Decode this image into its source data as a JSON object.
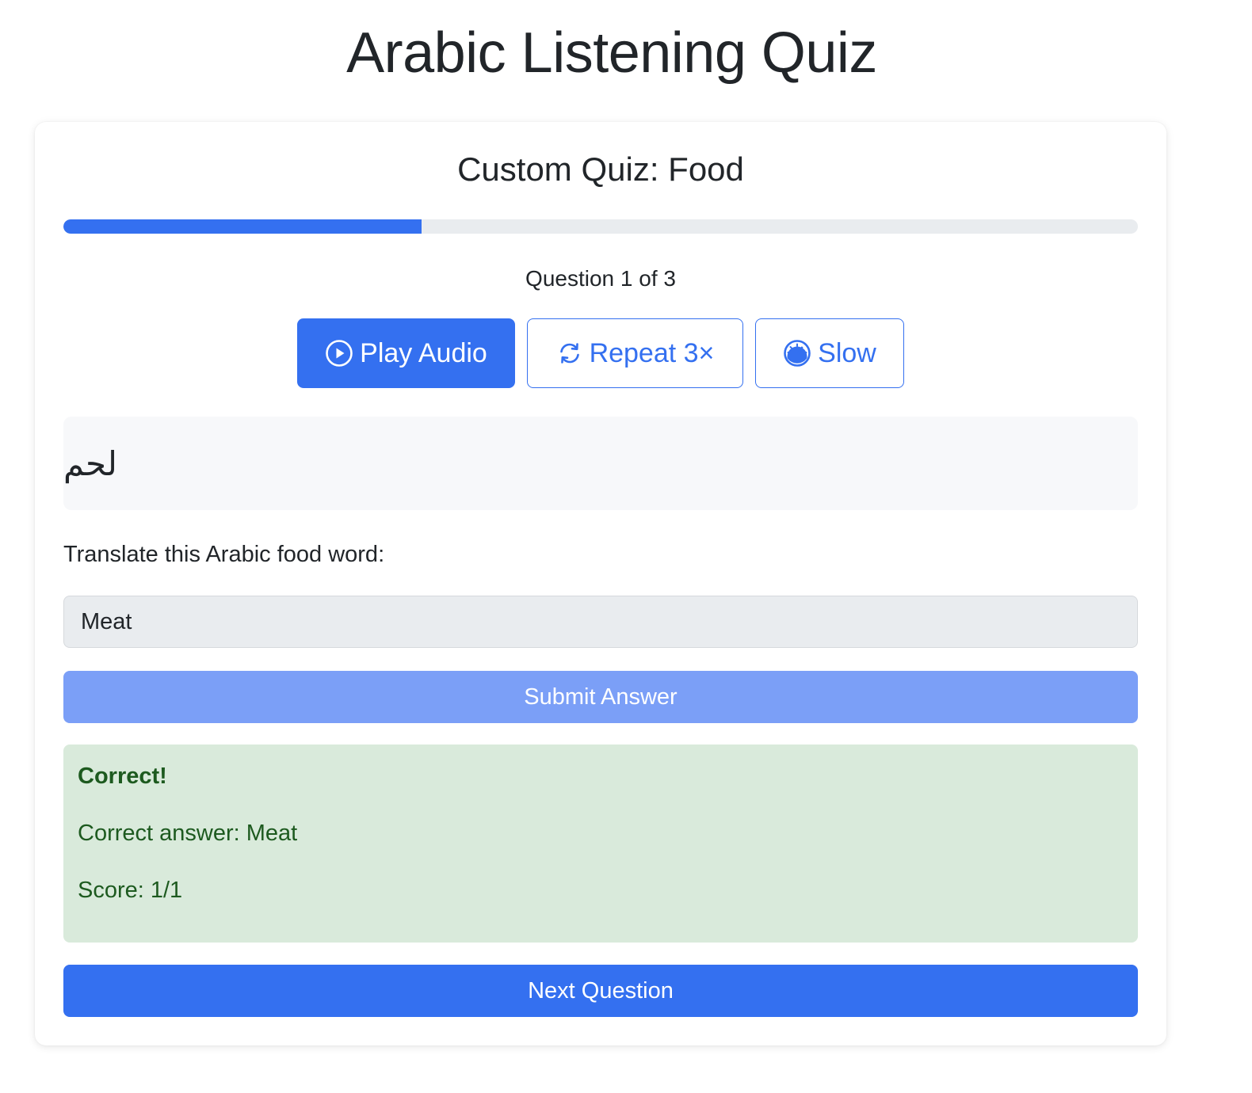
{
  "page": {
    "title": "Arabic Listening Quiz"
  },
  "quiz": {
    "title": "Custom Quiz: Food",
    "progress_fraction": 0.333,
    "counter": "Question 1 of 3",
    "arabic_word": "لحم",
    "prompt": "Translate this Arabic food word:"
  },
  "controls": {
    "play": {
      "label": "Play Audio",
      "icon": "play-circle-icon"
    },
    "repeat": {
      "label": "Repeat 3×",
      "icon": "repeat-arrows-icon"
    },
    "slow": {
      "label": "Slow",
      "icon": "speedometer-icon"
    }
  },
  "answer": {
    "value": "Meat",
    "placeholder": ""
  },
  "submit": {
    "label": "Submit Answer"
  },
  "feedback": {
    "heading": "Correct!",
    "correct_answer": "Correct answer: Meat",
    "score": "Score: 1/1"
  },
  "next": {
    "label": "Next Question"
  },
  "colors": {
    "primary": "#3470f0",
    "primary_disabled": "#7b9ff7",
    "success_bg": "#d9eadb",
    "success_text": "#1d5a1f",
    "progress_track": "#e9ecef"
  }
}
